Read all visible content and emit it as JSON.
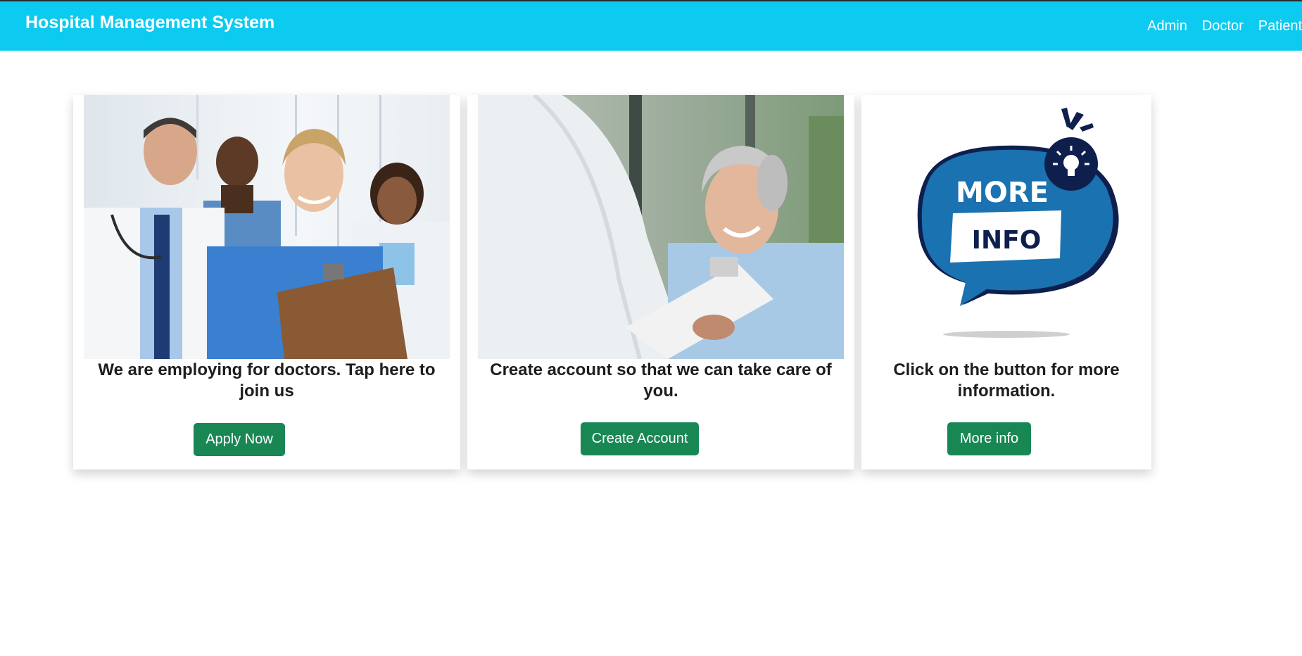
{
  "navbar": {
    "brand": "Hospital Management System",
    "links": [
      "Admin",
      "Doctor",
      "Patient"
    ]
  },
  "cards": [
    {
      "image": "doctors-team-photo",
      "text": "We are employing for doctors. Tap here to join us",
      "button": "Apply Now"
    },
    {
      "image": "patient-with-doctor-photo",
      "text": "Create account so that we can take care of you.",
      "button": "Create Account"
    },
    {
      "image": "more-info-bubble",
      "image_text": [
        "MORE",
        "INFO"
      ],
      "text": "Click on the button for more information.",
      "button": "More info"
    }
  ],
  "colors": {
    "navbar": "#0dcaf0",
    "button": "#198754",
    "bubble": "#1a72b0",
    "bubble_dark": "#0f1f4d"
  }
}
